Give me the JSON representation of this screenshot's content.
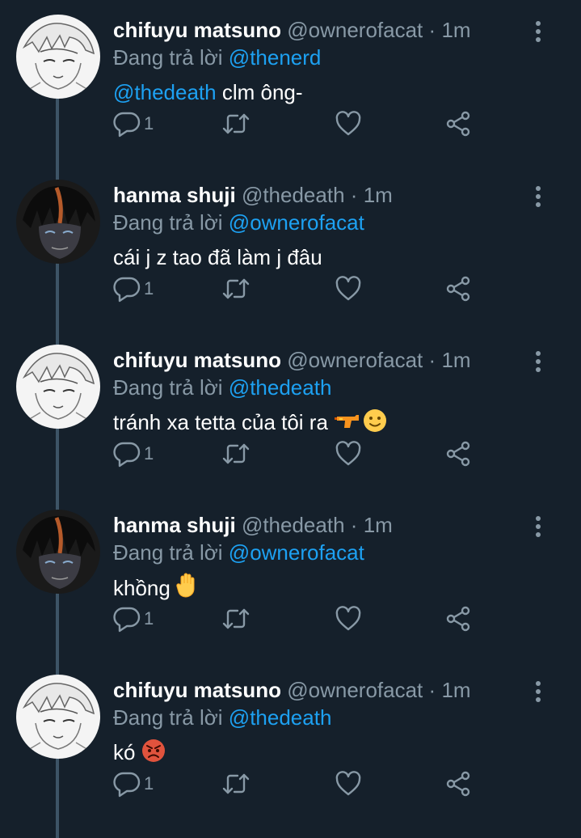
{
  "tweets": [
    {
      "name": "chifuyu matsuno",
      "handle": "@ownerofacat",
      "dot": "·",
      "time": "1m",
      "reply_prefix": "Đang trả lời",
      "reply_to": "@thenerd",
      "mention": "@thedeath",
      "text": " clm ông-",
      "reply_count": "1",
      "avatar": "light-manga-avatar"
    },
    {
      "name": "hanma shuji",
      "handle": "@thedeath",
      "dot": "·",
      "time": "1m",
      "reply_prefix": "Đang trả lời",
      "reply_to": "@ownerofacat",
      "text": "cái j z tao đã làm j đâu",
      "reply_count": "1",
      "avatar": "dark-manga-avatar"
    },
    {
      "name": "chifuyu matsuno",
      "handle": "@ownerofacat",
      "dot": "·",
      "time": "1m",
      "reply_prefix": "Đang trả lời",
      "reply_to": "@thedeath",
      "text": "tránh xa tetta của tôi ra ",
      "reply_count": "1",
      "emoji": [
        "water-pistol-emoji",
        "slightly-smiling-face-emoji"
      ],
      "avatar": "light-manga-avatar"
    },
    {
      "name": "hanma shuji",
      "handle": "@thedeath",
      "dot": "·",
      "time": "1m",
      "reply_prefix": "Đang trả lời",
      "reply_to": "@ownerofacat",
      "text": "khồng ",
      "reply_count": "1",
      "emoji": [
        "raised-hand-emoji"
      ],
      "avatar": "dark-manga-avatar"
    },
    {
      "name": "chifuyu matsuno",
      "handle": "@ownerofacat",
      "dot": "·",
      "time": "1m",
      "reply_prefix": "Đang trả lời",
      "reply_to": "@thedeath",
      "text": "kó ",
      "reply_count": "1",
      "emoji": [
        "angry-face-emoji"
      ],
      "avatar": "light-manga-avatar"
    }
  ],
  "icons": {
    "reply": "reply-icon",
    "retweet": "retweet-icon",
    "like": "heart-icon",
    "share": "share-icon",
    "more": "more-vertical-icon"
  },
  "colors": {
    "background": "#15202b",
    "secondary_text": "#8899a6",
    "link": "#1da1f2",
    "thread_line": "#3d5466"
  }
}
